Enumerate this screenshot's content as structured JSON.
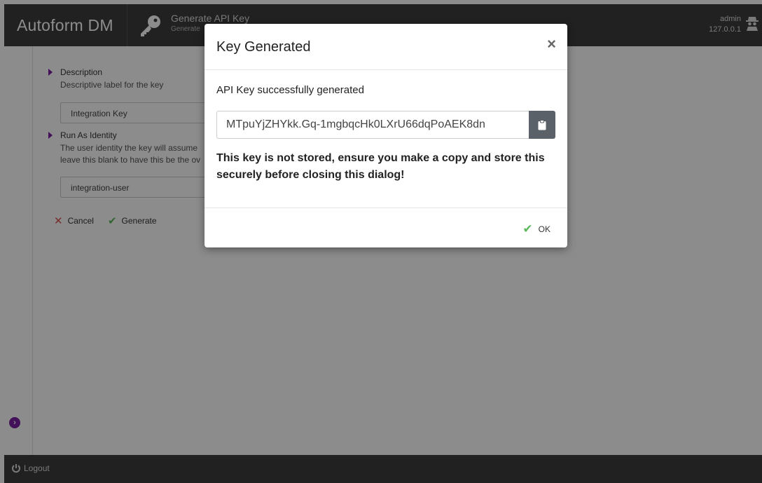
{
  "header": {
    "brand": "Autoform DM",
    "page_title": "Generate API Key",
    "page_subtitle": "Generate",
    "user_name": "admin",
    "user_ip": "127.0.0.1"
  },
  "form": {
    "description": {
      "label": "Description",
      "help": "Descriptive label for the key",
      "value": "Integration Key"
    },
    "run_as": {
      "label": "Run As Identity",
      "help_line1": "The user identity the key will assume",
      "help_line2": "leave this blank to have this be the ov",
      "value": "integration-user"
    },
    "cancel_label": "Cancel",
    "generate_label": "Generate"
  },
  "footer": {
    "logout_label": "Logout"
  },
  "modal": {
    "title": "Key Generated",
    "close_glyph": "×",
    "message": "API Key successfully generated",
    "api_key": "MTpuYjZHYkk.Gq-1mgbqcHk0LXrU66dqPoAEK8dn",
    "warning": "This key is not stored, ensure you make a copy and store this securely before closing this dialog!",
    "ok_label": "OK"
  },
  "colors": {
    "accent": "#7a1fa2",
    "header_bg": "#3d3d3d",
    "success": "#5cb85c",
    "cancel": "#d9534f"
  }
}
